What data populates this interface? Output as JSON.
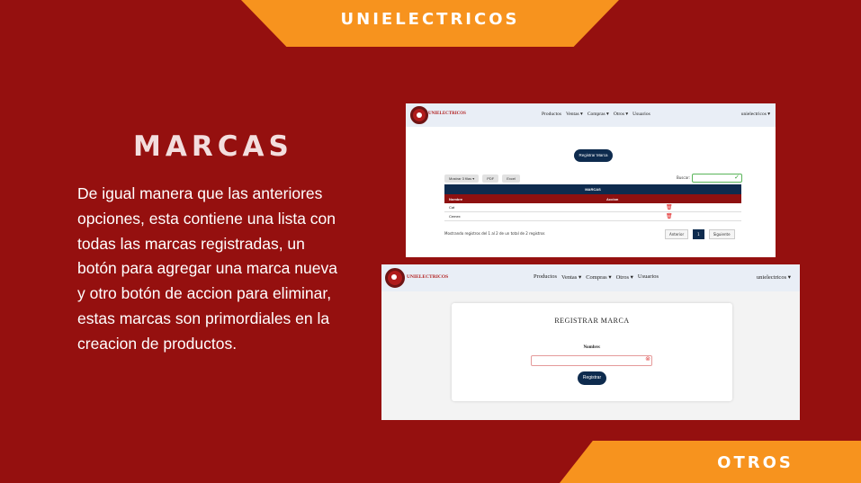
{
  "slide": {
    "top_banner": "UNIELECTRICOS",
    "bottom_banner": "OTROS",
    "title": "MARCAS",
    "body": "De igual manera que las anteriores opciones, esta contiene una lista con todas las marcas registradas, un botón para agregar una marca nueva y otro botón de accion para eliminar, estas marcas son primordiales en la creacion de productos."
  },
  "navbar": {
    "brand": "UNIELECTRICOS",
    "items": [
      "Productos",
      "Ventas ▾",
      "Compras ▾",
      "Otros ▾",
      "Usuarios"
    ],
    "user": "unielectricos ▾"
  },
  "list_view": {
    "register_button": "Registrar Marca",
    "toolbar": [
      "Mostrar 3 filas ▾",
      "PDF",
      "Excel"
    ],
    "search_label": "Buscar:",
    "table_caption": "MARCAS",
    "columns": [
      "Nombre",
      "Accion"
    ],
    "rows": [
      {
        "name": "Cat"
      },
      {
        "name": "Cemex"
      }
    ],
    "footer": "Mostrando registros del 1 al 2 de un total de 2 registros",
    "pager": {
      "prev": "Anterior",
      "current": "1",
      "next": "Siguiente"
    }
  },
  "form_view": {
    "title": "REGISTRAR MARCA",
    "field_label": "Nombre:",
    "field_value": "",
    "submit": "Registrar"
  },
  "colors": {
    "background": "#95100f",
    "accent": "#f7931e",
    "navy": "#0e2b4e",
    "table_head": "#8e1010"
  }
}
